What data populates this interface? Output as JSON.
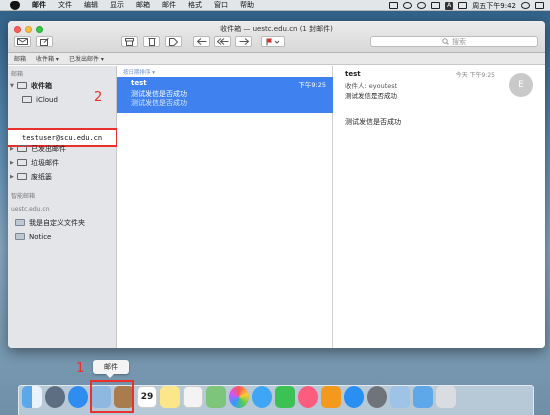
{
  "menubar": {
    "items": [
      "邮件",
      "文件",
      "编辑",
      "显示",
      "邮箱",
      "邮件",
      "格式",
      "窗口",
      "帮助"
    ],
    "input_badge": "A",
    "clock": "周五下午9:42"
  },
  "window": {
    "title": "收件箱 — uestc.edu.cn (1 封邮件)",
    "search_placeholder": "搜索",
    "favbar": [
      "邮箱",
      "收件箱 ▾",
      "已发出邮件 ▾"
    ]
  },
  "sidebar": {
    "section_mailboxes": "邮箱",
    "inbox": "收件箱",
    "icloud": "iCloud",
    "account": "testuser@scu.edu.cn",
    "sent": "已发出邮件",
    "junk": "垃圾邮件",
    "trash": "废纸篓",
    "section_smart": "智能邮箱",
    "section_account": "uestc.edu.cn",
    "custom_folder": "我是自定义文件夹",
    "notice": "Notice"
  },
  "list": {
    "sort_label": "按日期排序 ▾",
    "messages": [
      {
        "from": "test",
        "time": "下午9:25",
        "subject": "测试发信是否成功",
        "preview": "测试发信是否成功"
      }
    ]
  },
  "reader": {
    "from": "test",
    "time": "今天 下午9:25",
    "to": "收件人:  eyoutest",
    "subject": "测试发信是否成功",
    "avatar_letter": "E",
    "body": "测试发信是否成功"
  },
  "annotations": {
    "step1": "1",
    "step2": "2"
  },
  "dock": {
    "tooltip": "邮件",
    "calendar_day": "29",
    "icons": [
      "finder-icon",
      "launchpad-icon",
      "safari-icon",
      "mail-icon",
      "contacts-icon",
      "calendar-icon",
      "notes-icon",
      "reminders-icon",
      "maps-icon",
      "photos-icon",
      "messages-icon",
      "facetime-icon",
      "music-icon",
      "ibooks-icon",
      "appstore-icon",
      "preferences-icon",
      "preview-icon",
      "downloads-icon",
      "trash-icon"
    ]
  },
  "colors": {
    "selection": "#3f82ef",
    "annotation": "#e8302c",
    "sidebar": "#e3e5e8"
  }
}
